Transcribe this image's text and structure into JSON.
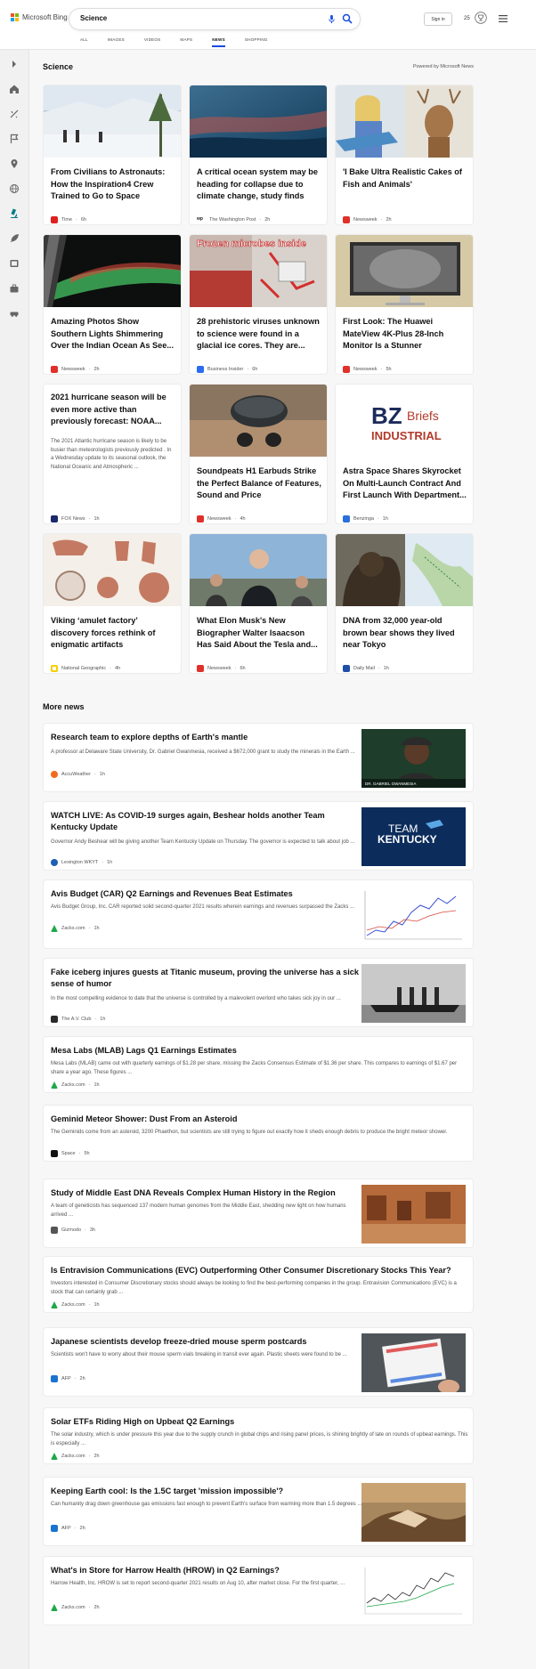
{
  "header": {
    "logo_text": "Microsoft Bing",
    "search_value": "Science",
    "signin_label": "Sign in",
    "rewards_count": "25",
    "tabs": [
      "ALL",
      "IMAGES",
      "VIDEOS",
      "MAPS",
      "NEWS",
      "SHOPPING"
    ],
    "active_tab": "NEWS"
  },
  "section": {
    "title": "Science",
    "powered": "Powered by Microsoft News"
  },
  "cards": [
    {
      "title": "From Civilians to Astronauts: How the Inspiration4 Crew Trained to Go to Space",
      "source": "Time",
      "age": "6h",
      "fav_color": "#e02020"
    },
    {
      "title": "A critical ocean system may be heading for collapse due to climate change, study finds",
      "source": "The Washington Post",
      "age": "2h",
      "fav_color": "#222222"
    },
    {
      "title": "'I Bake Ultra Realistic Cakes of Fish and Animals'",
      "source": "Newsweek",
      "age": "2h",
      "fav_color": "#e0302a"
    },
    {
      "title": "Amazing Photos Show Southern Lights Shimmering Over the Indian Ocean As See...",
      "source": "Newsweek",
      "age": "2h",
      "fav_color": "#e0302a"
    },
    {
      "title": "28 prehistoric viruses unknown to science were found in a glacial ice cores. They are...",
      "source": "Business Insider",
      "age": "6h",
      "fav_color": "#2b6cf0"
    },
    {
      "title": "First Look: The Huawei MateView 4K-Plus 28-Inch Monitor Is a Stunner",
      "source": "Newsweek",
      "age": "5h",
      "fav_color": "#e0302a"
    },
    {
      "title": "2021 hurricane season will be even more active than previously forecast: NOAA...",
      "snippet": "The 2021 Atlantic hurricane season is likely to be busier than meteorologists previously predicted . In a Wednesday update to its seasonal outlook, the National Oceanic and Atmospheric ...",
      "source": "FOX News",
      "age": "1h",
      "fav_color": "#1a2a6c"
    },
    {
      "title": "Soundpeats H1 Earbuds Strike the Perfect Balance of Features, Sound and Price",
      "source": "Newsweek",
      "age": "4h",
      "fav_color": "#e0302a"
    },
    {
      "title": "Astra Space Shares Skyrocket On Multi-Launch Contract And First Launch With Department...",
      "source": "Benzinga",
      "age": "1h",
      "fav_color": "#2a6fdb"
    },
    {
      "title": "Viking ‘amulet factory’ discovery forces rethink of enigmatic artifacts",
      "source": "National Geographic",
      "age": "4h",
      "fav_color": "#f5d000"
    },
    {
      "title": "What Elon Musk's New Biographer Walter Isaacson Has Said About the Tesla and...",
      "source": "Newsweek",
      "age": "6h",
      "fav_color": "#e0302a"
    },
    {
      "title": "DNA from 32,000 year-old brown bear shows they lived near Tokyo",
      "source": "Daily Mail",
      "age": "1h",
      "fav_color": "#1f4fa8"
    }
  ],
  "image_labels": {
    "frozen_microbes": "Frozen microbes inside",
    "bz_briefs": "BZ",
    "bz_briefs_word": "Briefs",
    "bz_industrial": "INDUSTRIAL",
    "team": "TEAM",
    "kentucky": "KENTUCKY",
    "gabriel_caption": "DR. GABRIEL GWANMESIA"
  },
  "more_news": {
    "title": "More news",
    "items": [
      {
        "title": "Research team to explore depths of Earth's mantle",
        "snippet": "A professor at Delaware State University, Dr. Gabriel Gwanmesia, received a $672,000 grant to study the minerals in the Earth ...",
        "source": "AccuWeather",
        "age": "1h",
        "fav_color": "#f26b1d"
      },
      {
        "title": "WATCH LIVE: As COVID-19 surges again, Beshear holds another Team Kentucky Update",
        "snippet": "Governor Andy Beshear will be giving another Team Kentucky Update on Thursday. The governor is expected to talk about job ...",
        "source": "Lexington WKYT",
        "age": "1h",
        "fav_color": "#1d5fb4"
      },
      {
        "title": "Avis Budget (CAR) Q2 Earnings and Revenues Beat Estimates",
        "snippet": "Avis Budget Group, Inc. CAR reported solid second-quarter 2021 results wherein earnings and revenues surpassed the Zacks ...",
        "source": "Zacks.com",
        "age": "1h",
        "fav_color": "#1fa84a"
      },
      {
        "title": "Fake iceberg injures guests at Titanic museum, proving the universe has a sick sense of humor",
        "snippet": "In the most compelling evidence to date that the universe is controlled by a malevolent overlord who takes sick joy in our ...",
        "source": "The A.V. Club",
        "age": "1h",
        "fav_color": "#2a2a2a"
      },
      {
        "title": "Mesa Labs (MLAB) Lags Q1 Earnings Estimates",
        "snippet": "Mesa Labs (MLAB) came out with quarterly earnings of $1.28 per share, missing the Zacks Consensus Estimate of $1.36 per share. This compares to earnings of $1.67 per share a year ago. These figures ...",
        "source": "Zacks.com",
        "age": "1h",
        "fav_color": "#1fa84a"
      },
      {
        "title": "Geminid Meteor Shower: Dust From an Asteroid",
        "snippet": "The Geminids come from an asteroid, 3200 Phaethon, but scientists are still trying to figure out exactly how it sheds enough debris to produce the bright meteor shower.",
        "source": "Space",
        "age": "5h",
        "fav_color": "#111111"
      },
      {
        "title": "Study of Middle East DNA Reveals Complex Human History in the Region",
        "snippet": "A team of geneticists has sequenced 137 modern human genomes from the Middle East, shedding new light on how humans arrived ...",
        "source": "Gizmodo",
        "age": "3h",
        "fav_color": "#555555"
      },
      {
        "title": "Is Entravision Communications (EVC) Outperforming Other Consumer Discretionary Stocks This Year?",
        "snippet": "Investors interested in Consumer Discretionary stocks should always be looking to find the best-performing companies in the group. Entravision Communications (EVC) is a stock that can certainly grab ...",
        "source": "Zacks.com",
        "age": "1h",
        "fav_color": "#1fa84a"
      },
      {
        "title": "Japanese scientists develop freeze-dried mouse sperm postcards",
        "snippet": "Scientists won't have to worry about their mouse sperm vials breaking in transit ever again. Plastic sheets were found to be ...",
        "source": "AFP",
        "age": "2h",
        "fav_color": "#1b73d1"
      },
      {
        "title": "Solar ETFs Riding High on Upbeat Q2 Earnings",
        "snippet": "The solar industry, which is under pressure this year due to the supply crunch in global chips and rising panel prices, is shining brightly of late on rounds of upbeat earnings. This is especially ...",
        "source": "Zacks.com",
        "age": "2h",
        "fav_color": "#1fa84a"
      },
      {
        "title": "Keeping Earth cool: Is the 1.5C target 'mission impossible'?",
        "snippet": "Can humanity drag down greenhouse gas emissions fast enough to prevent Earth's surface from warming more than 1.5 degrees ...",
        "source": "AFP",
        "age": "2h",
        "fav_color": "#1b73d1"
      },
      {
        "title": "What's in Store for Harrow Health (HROW) in Q2 Earnings?",
        "snippet": "Harrow Health, Inc. HROW is set to report second-quarter 2021 results on Aug 10, after market close. For the first quarter, ...",
        "source": "Zacks.com",
        "age": "2h",
        "fav_color": "#1fa84a"
      }
    ]
  }
}
